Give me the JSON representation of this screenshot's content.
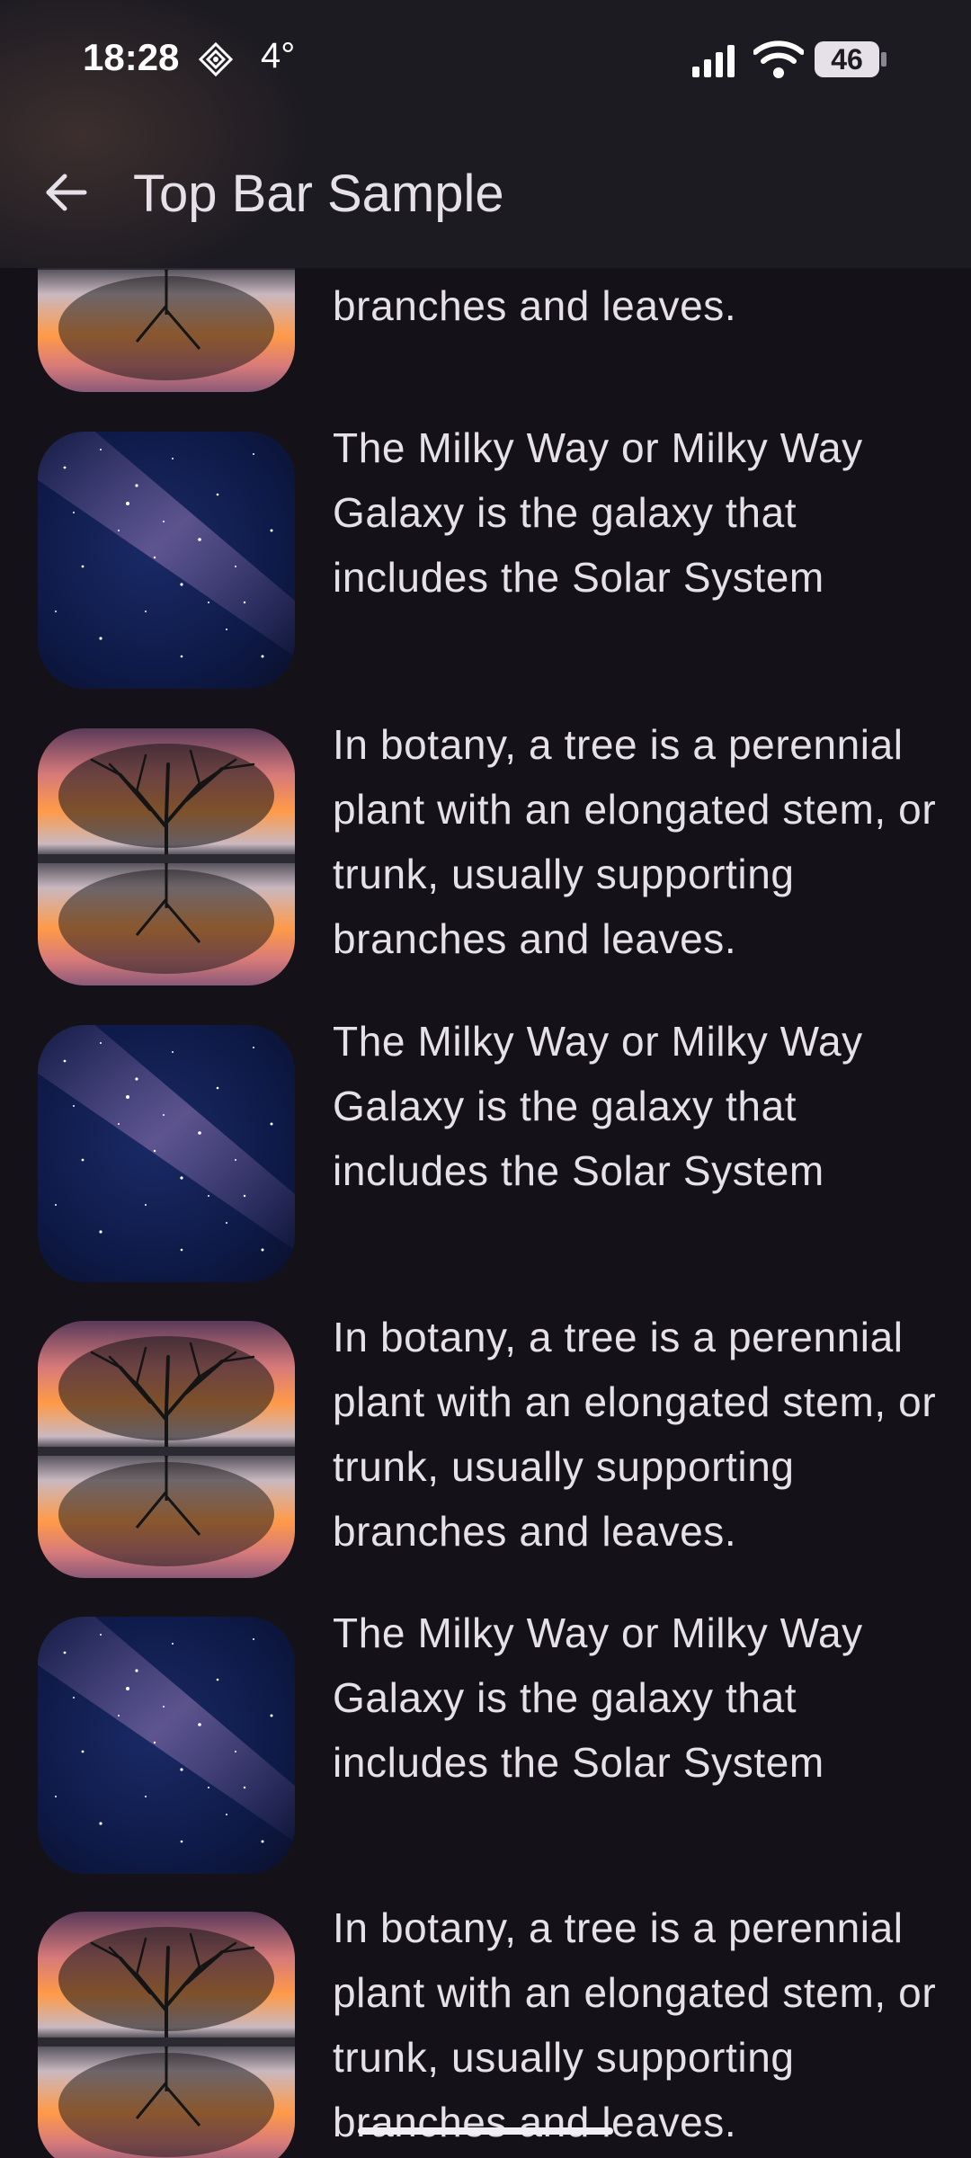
{
  "status_bar": {
    "time": "18:28",
    "temperature": "4°",
    "battery_level": "46",
    "app_icon": "weather-app-icon",
    "signal_icon": "cell-signal-icon",
    "wifi_icon": "wifi-icon"
  },
  "app_bar": {
    "title": "Top Bar Sample",
    "back_icon": "arrow-back-icon"
  },
  "items": [
    {
      "image": "tree-reflection",
      "text": "In botany, a tree is a perennial plant with an elongated stem, or trunk, usually supporting branches and leaves."
    },
    {
      "image": "milky-way",
      "text": "The Milky Way or Milky Way Galaxy is the galaxy that includes the Solar System"
    },
    {
      "image": "tree-reflection",
      "text": "In botany, a tree is a perennial plant with an elongated stem, or trunk, usually supporting branches and leaves."
    },
    {
      "image": "milky-way",
      "text": "The Milky Way or Milky Way Galaxy is the galaxy that includes the Solar System"
    },
    {
      "image": "tree-reflection",
      "text": "In botany, a tree is a perennial plant with an elongated stem, or trunk, usually supporting branches and leaves."
    },
    {
      "image": "milky-way",
      "text": "The Milky Way or Milky Way Galaxy is the galaxy that includes the Solar System"
    },
    {
      "image": "tree-reflection",
      "text": "In botany, a tree is a perennial plant with an elongated stem, or trunk, usually supporting branches and leaves."
    }
  ],
  "colors": {
    "background": "#141218",
    "top_bar": "#1d1b22",
    "text": "#e6e0e9"
  }
}
